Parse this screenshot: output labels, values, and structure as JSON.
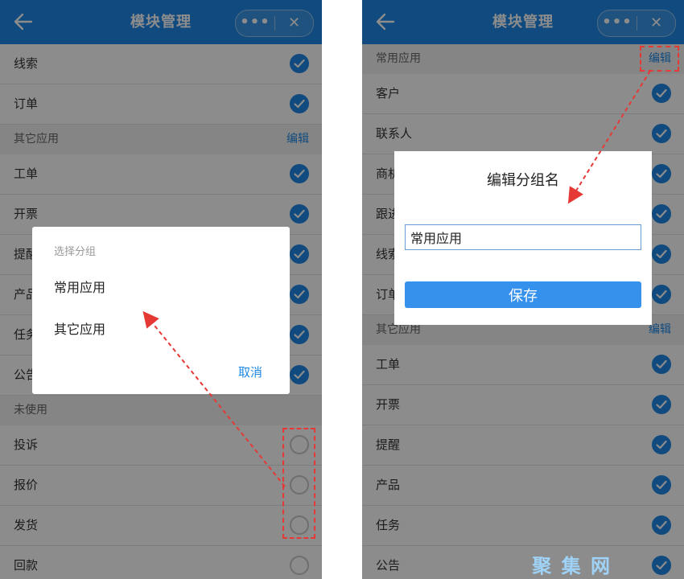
{
  "left": {
    "title": "模块管理",
    "more_icon": "•••",
    "close_icon": "✕",
    "rows_top": [
      {
        "label": "线索",
        "checked": true
      },
      {
        "label": "订单",
        "checked": true
      }
    ],
    "section_other": {
      "label": "其它应用",
      "action": "编辑"
    },
    "rows_other": [
      {
        "label": "工单",
        "checked": true
      },
      {
        "label": "开票",
        "checked": true
      },
      {
        "label": "提醒",
        "checked": true
      },
      {
        "label": "产品",
        "checked": true
      },
      {
        "label": "任务",
        "checked": true
      },
      {
        "label": "公告",
        "checked": true
      }
    ],
    "section_unused": {
      "label": "未使用"
    },
    "rows_unused": [
      {
        "label": "投诉",
        "checked": false
      },
      {
        "label": "报价",
        "checked": false
      },
      {
        "label": "发货",
        "checked": false
      },
      {
        "label": "回款",
        "checked": false
      }
    ],
    "dialog": {
      "caption": "选择分组",
      "option_1": "常用应用",
      "option_2": "其它应用",
      "cancel": "取消"
    }
  },
  "right": {
    "title": "模块管理",
    "more_icon": "•••",
    "close_icon": "✕",
    "section_common": {
      "label": "常用应用",
      "action": "编辑"
    },
    "rows_common": [
      {
        "label": "客户",
        "checked": true
      },
      {
        "label": "联系人",
        "checked": true
      },
      {
        "label": "商机",
        "checked": true
      },
      {
        "label": "跟进",
        "checked": true
      },
      {
        "label": "线索",
        "checked": true
      },
      {
        "label": "订单",
        "checked": true
      }
    ],
    "section_other": {
      "label": "其它应用",
      "action": "编辑"
    },
    "rows_other": [
      {
        "label": "工单",
        "checked": true
      },
      {
        "label": "开票",
        "checked": true
      },
      {
        "label": "提醒",
        "checked": true
      },
      {
        "label": "产品",
        "checked": true
      },
      {
        "label": "任务",
        "checked": true
      },
      {
        "label": "公告",
        "checked": true
      }
    ],
    "dialog": {
      "title": "编辑分组名",
      "input_value": "常用应用",
      "save": "保存"
    }
  },
  "watermark": "聚 集 网",
  "colors": {
    "accent": "#1e88e5",
    "annotation": "#e53935"
  }
}
